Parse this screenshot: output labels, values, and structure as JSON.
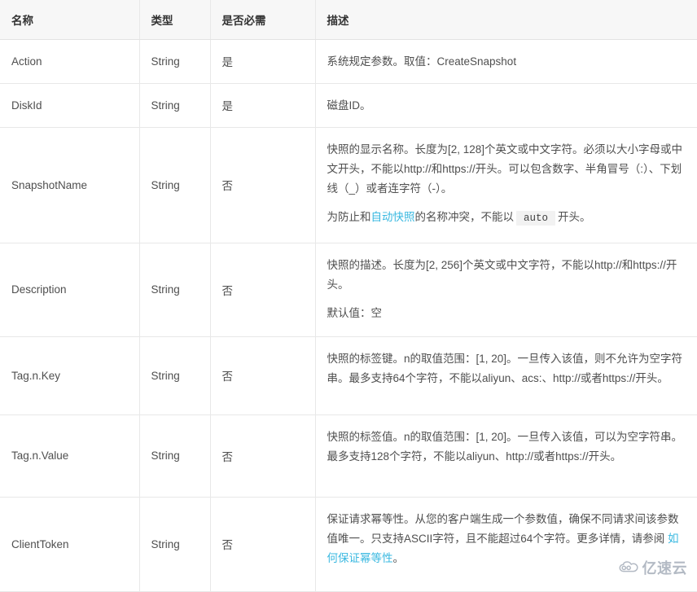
{
  "table": {
    "headers": [
      "名称",
      "类型",
      "是否必需",
      "描述"
    ],
    "rows": [
      {
        "name": "Action",
        "type": "String",
        "required": "是",
        "desc_paras": [
          [
            {
              "t": "text",
              "v": "系统规定参数。取值：CreateSnapshot"
            }
          ]
        ]
      },
      {
        "name": "DiskId",
        "type": "String",
        "required": "是",
        "desc_paras": [
          [
            {
              "t": "text",
              "v": "磁盘ID。"
            }
          ]
        ]
      },
      {
        "name": "SnapshotName",
        "type": "String",
        "required": "否",
        "desc_paras": [
          [
            {
              "t": "text",
              "v": "快照的显示名称。长度为[2, 128]个英文或中文字符。必须以大小字母或中文开头，不能以http://和https://开头。可以包含数字、半角冒号（:）、下划线（_）或者连字符（-）。"
            }
          ],
          [
            {
              "t": "text",
              "v": "为防止和"
            },
            {
              "t": "link",
              "v": "自动快照"
            },
            {
              "t": "text",
              "v": "的名称冲突，不能以"
            },
            {
              "t": "code",
              "v": "auto"
            },
            {
              "t": "text",
              "v": "开头。"
            }
          ]
        ]
      },
      {
        "name": "Description",
        "type": "String",
        "required": "否",
        "desc_paras": [
          [
            {
              "t": "text",
              "v": "快照的描述。长度为[2, 256]个英文或中文字符，不能以http://和https://开头。"
            }
          ],
          [
            {
              "t": "text",
              "v": "默认值：空"
            }
          ]
        ]
      },
      {
        "name": "Tag.n.Key",
        "type": "String",
        "required": "否",
        "desc_paras": [
          [
            {
              "t": "text",
              "v": "快照的标签键。n的取值范围：[1, 20]。一旦传入该值，则不允许为空字符串。最多支持64个字符，不能以aliyun、acs:、http://或者https://开头。"
            }
          ]
        ]
      },
      {
        "name": "Tag.n.Value",
        "type": "String",
        "required": "否",
        "desc_paras": [
          [
            {
              "t": "text",
              "v": "快照的标签值。n的取值范围：[1, 20]。一旦传入该值，可以为空字符串。最多支持128个字符，不能以aliyun、http://或者https://开头。"
            }
          ]
        ]
      },
      {
        "name": "ClientToken",
        "type": "String",
        "required": "否",
        "desc_paras": [
          [
            {
              "t": "text",
              "v": "保证请求幂等性。从您的客户端生成一个参数值，确保不同请求间该参数值唯一。只支持ASCII字符，且不能超过64个字符。更多详情，请参阅 "
            },
            {
              "t": "link",
              "v": "如何保证幂等性"
            },
            {
              "t": "text",
              "v": "。"
            }
          ]
        ]
      }
    ]
  },
  "watermark": {
    "text": "亿速云",
    "icon": "cloud-logo-icon"
  },
  "colors": {
    "link": "#39b8e0",
    "header_bg": "#f7f7f7",
    "border": "#e8e8e8",
    "text": "#4f4f4f",
    "watermark": "#97a0ae"
  }
}
